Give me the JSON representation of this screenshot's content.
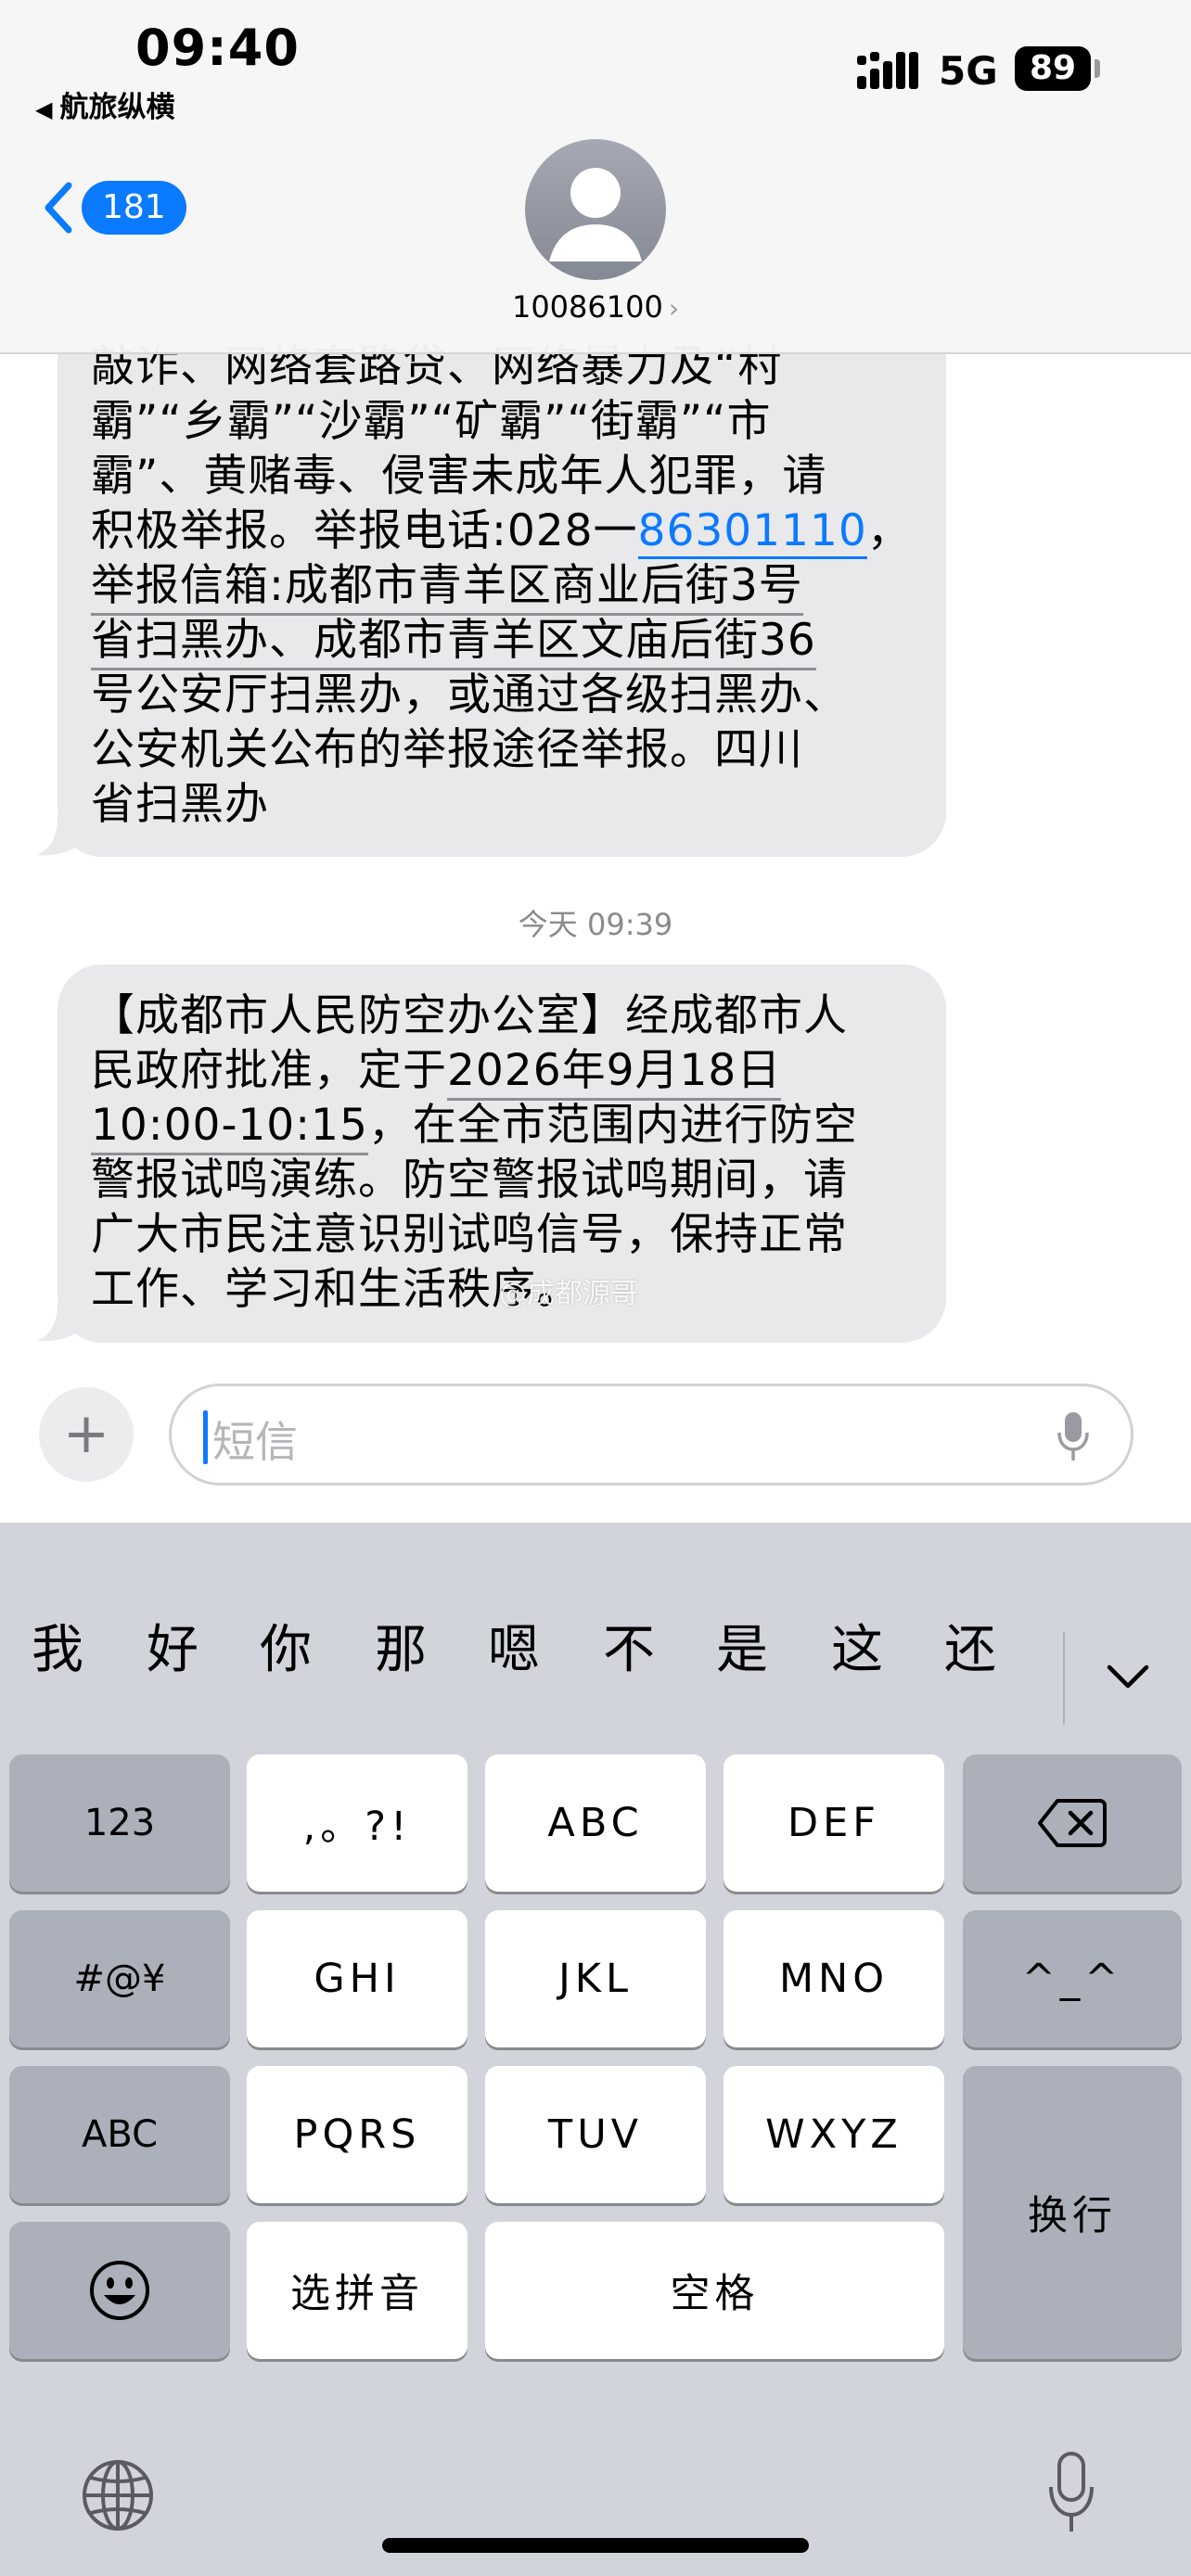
{
  "status_bar": {
    "time": "09:40",
    "back_app": "航旅纵横",
    "network": "5G",
    "battery": "89"
  },
  "header": {
    "back_count": "181",
    "contact_name": "10086100",
    "contact_chevron": "›"
  },
  "messages": {
    "top_lines": [
      "敲诈、网络套路贷、网络暴力及“村",
      "霸”“乡霸”“沙霸”“矿霸”“街霸”“市",
      "霸”、黄赌毒、侵害未成年人犯罪，请",
      "积极举报。举报电话:028一",
      "举报信箱:成都市青羊区商业后街3号",
      "省扫黑办、成都市青羊区文庙后街36",
      "号公安厅扫黑办，或通过各级扫黑办、",
      "公安机关公布的举报途径举报。四川",
      "省扫黑办"
    ],
    "top_phone_link": "86301110",
    "top_phone_suffix": "，",
    "timestamp": "今天 09:39",
    "bottom_lines": [
      "【成都市人民防空办公室】经成都市人",
      "民政府批准，定于",
      "，在全市范围内进行防空",
      "警报试鸣演练。防空警报试鸣期间，请",
      "广大市民注意识别试鸣信号，保持正常",
      "工作、学习和生活秩序。"
    ],
    "bottom_date": "2026年9月18日",
    "bottom_time": "10:00-10:15",
    "watermark": "@成都源哥"
  },
  "input": {
    "placeholder": "短信",
    "plus": "+"
  },
  "keyboard": {
    "candidates": [
      "我",
      "好",
      "你",
      "那",
      "嗯",
      "不",
      "是",
      "这",
      "还"
    ],
    "keys": {
      "num": "123",
      "punct": ",。?!",
      "abc": "ABC",
      "def": "DEF",
      "sym": "#@¥",
      "ghi": "GHI",
      "jkl": "JKL",
      "mno": "MNO",
      "emoticon": "^_^",
      "abc_mode": "ABC",
      "pqrs": "PQRS",
      "tuv": "TUV",
      "wxyz": "WXYZ",
      "return": "换行",
      "pinyin": "选拼音",
      "space": "空格"
    },
    "icons": [
      "delete-icon",
      "emoji-icon",
      "globe-icon",
      "microphone-icon",
      "chevron-down-icon"
    ]
  },
  "colors": {
    "accent": "#0a7aff",
    "bubble": "#e9e9eb",
    "keyboard_bg": "#d1d4db",
    "key_gray": "#abb0ba"
  }
}
